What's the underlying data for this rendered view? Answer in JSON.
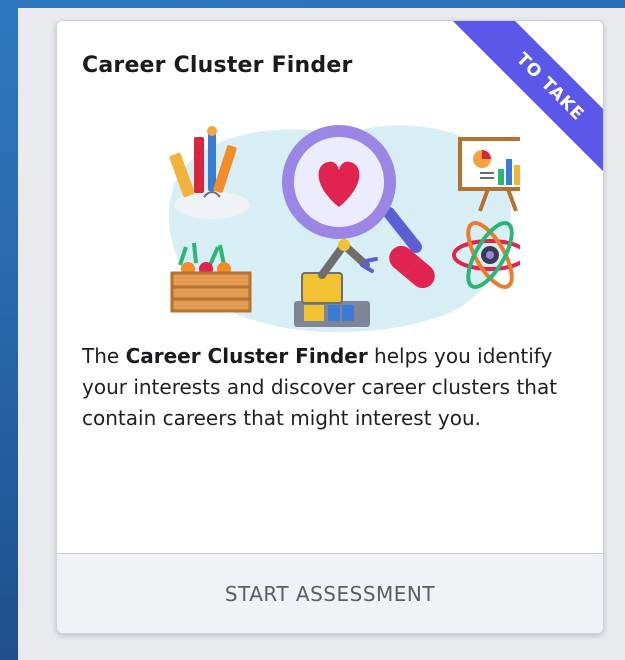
{
  "card": {
    "title": "Career Cluster Finder",
    "ribbon": "TO TAKE",
    "description": {
      "prefix": "The ",
      "bold": "Career Cluster Finder",
      "suffix": " helps you identify your interests and discover career clusters that contain careers that might interest you."
    },
    "action_label": "START ASSESSMENT"
  },
  "illustration": {
    "icons": [
      "art-supplies-icon",
      "magnifier-heart-icon",
      "presentation-chart-icon",
      "atom-icon",
      "vegetable-crate-icon",
      "robot-arm-icon",
      "capsule-icon"
    ],
    "colors": {
      "accent": "#5b57e8",
      "blob": "#d7eef4",
      "heart": "#e0234f",
      "lens_ring": "#9b86e6"
    }
  }
}
